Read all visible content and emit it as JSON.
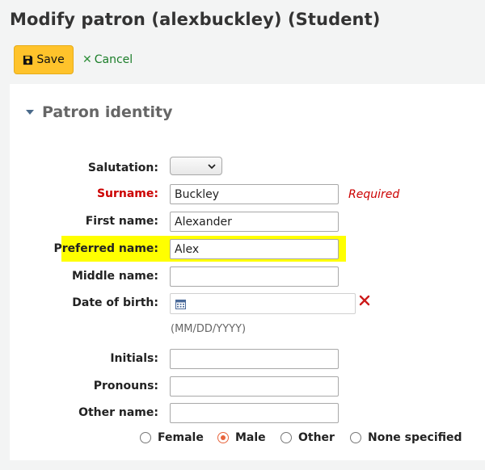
{
  "page_title": "Modify patron (alexbuckley) (Student)",
  "toolbar": {
    "save_label": "Save",
    "cancel_label": "Cancel",
    "save_icon": "floppy-disk-icon",
    "cancel_icon": "x-icon"
  },
  "section": {
    "title": "Patron identity",
    "toggle_icon": "collapse-triangle-icon"
  },
  "fields": {
    "salutation": {
      "label": "Salutation:",
      "value": ""
    },
    "surname": {
      "label": "Surname:",
      "value": "Buckley",
      "note": "Required"
    },
    "firstname": {
      "label": "First name:",
      "value": "Alexander"
    },
    "preferred": {
      "label": "Preferred name:",
      "value": "Alex"
    },
    "middle": {
      "label": "Middle name:",
      "value": ""
    },
    "dob": {
      "label": "Date of birth:",
      "value": "",
      "hint": "(MM/DD/YYYY)",
      "calendar_icon": "calendar-icon",
      "clear_icon": "clear-x-icon"
    },
    "initials": {
      "label": "Initials:",
      "value": ""
    },
    "pronouns": {
      "label": "Pronouns:",
      "value": ""
    },
    "othername": {
      "label": "Other name:",
      "value": ""
    }
  },
  "gender": {
    "options": [
      "Female",
      "Male",
      "Other",
      "None specified"
    ],
    "selected": "Male"
  },
  "colors": {
    "save_button": "#ffc32b",
    "required": "#cc0000",
    "highlight": "#ffff00",
    "radio_checked": "#e8643c",
    "cancel_link": "#1a7d28"
  }
}
